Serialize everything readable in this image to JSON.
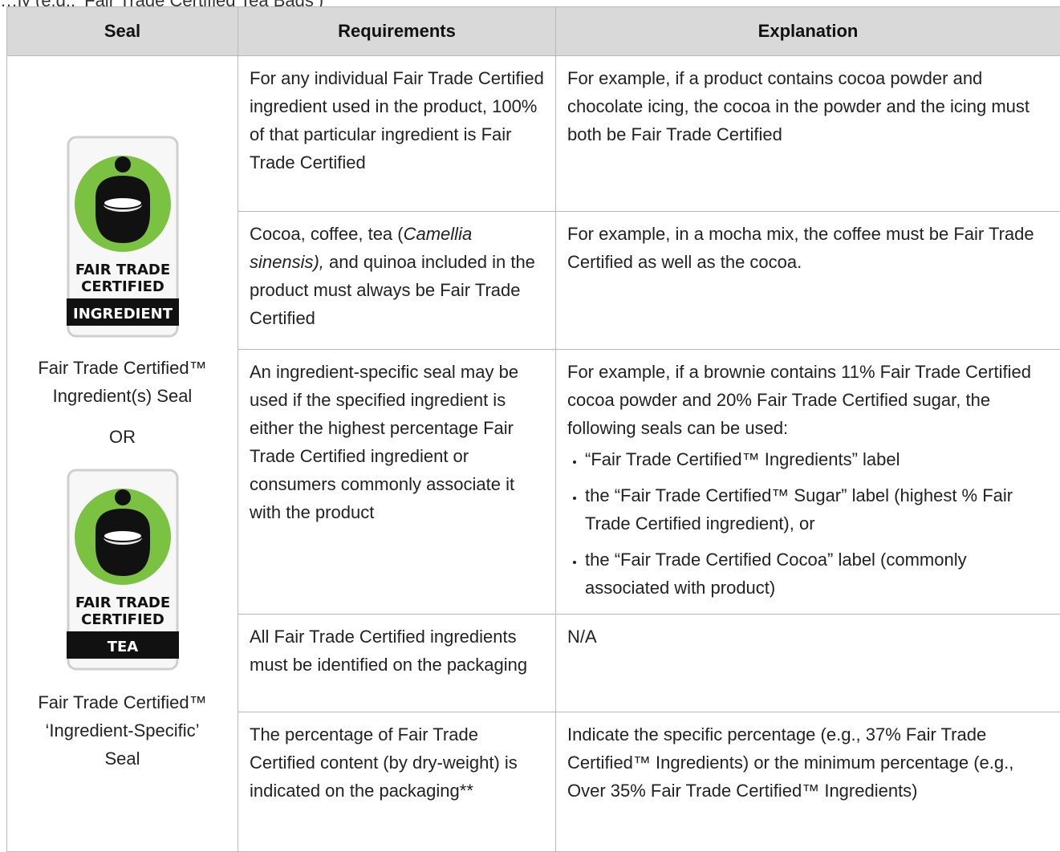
{
  "top_text": "…ly (e.g., ‘Fair Trade Certified Tea Bags’)",
  "headers": {
    "seal": "Seal",
    "requirements": "Requirements",
    "explanation": "Explanation"
  },
  "seal_column": {
    "badge1": {
      "line1": "FAIR TRADE",
      "line2": "CERTIFIED",
      "band": "INGREDIENT"
    },
    "label1_line1": "Fair Trade Certified™",
    "label1_line2": "Ingredient(s) Seal",
    "or": "OR",
    "badge2": {
      "line1": "FAIR TRADE",
      "line2": "CERTIFIED",
      "band": "TEA"
    },
    "label2_line1": "Fair Trade Certified™",
    "label2_line2": "‘Ingredient-Specific’",
    "label2_line3": "Seal"
  },
  "rows": [
    {
      "req": "For any individual Fair Trade Certified ingredient used in the product, 100% of that particular ingredient is Fair Trade Certified",
      "exp": "For example, if a product contains cocoa powder and chocolate icing, the cocoa in the powder and the icing must both be Fair Trade Certified"
    },
    {
      "req_a": "Cocoa, coffee, tea (",
      "req_italic": "Camellia sinensis),",
      "req_b": " and quinoa included in the product must always be Fair Trade Certified",
      "exp": "For example, in a mocha mix, the coffee must be Fair Trade Certified as well as the cocoa."
    },
    {
      "req": "An ingredient-specific seal may be used if the specified ingredient is either the highest percentage Fair Trade Certified ingredient or consumers commonly associate it with the product",
      "exp": "For example, if a brownie contains 11% Fair Trade Certified cocoa powder and 20% Fair Trade Certified sugar, the following seals can be used:",
      "bullets": [
        "“Fair Trade Certified™ Ingredients” label",
        "the “Fair Trade Certified™ Sugar” label (highest % Fair Trade Certified ingredient), or",
        "the “Fair Trade Certified Cocoa” label (commonly associated with product)"
      ]
    },
    {
      "req": "All Fair Trade Certified ingredients must be identified on the packaging",
      "exp": "N/A"
    },
    {
      "req": "The percentage of Fair Trade Certified content (by dry-weight) is indicated on the packaging**",
      "exp": "Indicate the specific percentage (e.g., 37% Fair Trade Certified™ Ingredients) or the minimum percentage (e.g., Over 35% Fair Trade Certified™ Ingredients)"
    }
  ],
  "colors": {
    "header_bg": "#d9d9d9",
    "border": "#b9b9b9",
    "seal_green": "#7cc242",
    "seal_black": "#111111"
  }
}
